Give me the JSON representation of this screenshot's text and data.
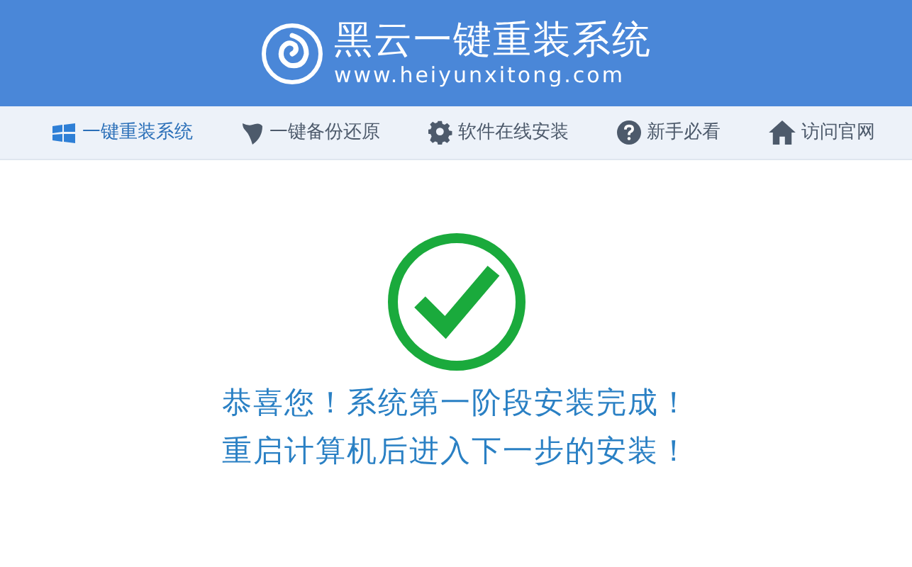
{
  "header": {
    "title": "黑云一键重装系统",
    "url": "www.heiyunxitong.com"
  },
  "tabs": [
    {
      "label": "一键重装系统",
      "kind": "windows",
      "selected": true
    },
    {
      "label": "一键备份还原",
      "kind": "backup",
      "selected": false
    },
    {
      "label": "软件在线安装",
      "kind": "gear",
      "selected": false
    },
    {
      "label": "新手必看",
      "kind": "help",
      "selected": false
    },
    {
      "label": "访问官网",
      "kind": "home",
      "selected": false
    }
  ],
  "message": {
    "lines": [
      "恭喜您！系统第一阶段安装完成！",
      "重启计算机后进入下一步的安装！"
    ]
  }
}
